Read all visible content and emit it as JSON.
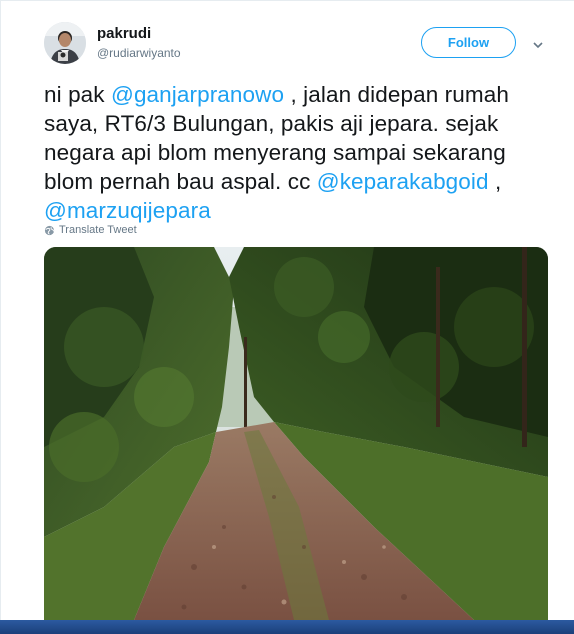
{
  "user": {
    "display_name": "pakrudi",
    "handle": "@rudiarwiyanto"
  },
  "actions": {
    "follow_label": "Follow"
  },
  "tweet": {
    "text_parts": {
      "p1": "ni pak ",
      "m1": "@ganjarpranowo",
      "p2": " , jalan didepan rumah saya, RT6/3 Bulungan, pakis aji jepara. sejak negara api blom menyerang sampai sekarang blom pernah bau aspal. cc ",
      "m2": "@keparakabgoid",
      "p3": " , ",
      "m3": "@marzuqijepara"
    },
    "translate_label": "Translate Tweet"
  },
  "colors": {
    "accent": "#1da1f2",
    "text": "#14171a",
    "muted": "#657786"
  }
}
